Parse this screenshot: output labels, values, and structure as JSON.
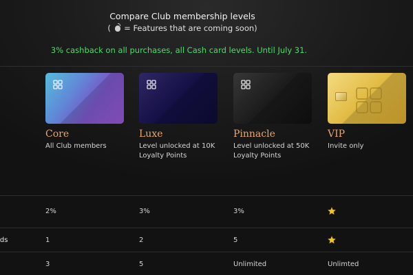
{
  "header": {
    "title": "Compare Club membership levels",
    "subtitle_open": "(",
    "subtitle_rest": " = Features that are coming soon)",
    "coming_soon_icon": "bomb-icon"
  },
  "promo": {
    "text": "3% cashback on all purchases, all Cash card levels. Until July 31.",
    "color": "#4ade6a"
  },
  "tiers": [
    {
      "name": "Core",
      "description": "All Club members",
      "card_style": "blue-purple gradient"
    },
    {
      "name": "Luxe",
      "description": "Level unlocked at 10K Loyalty Points",
      "card_style": "deep indigo"
    },
    {
      "name": "Pinnacle",
      "description": "Level unlocked at 50K Loyalty Points",
      "card_style": "black"
    },
    {
      "name": "VIP",
      "description": "Invite only",
      "card_style": "gold with chip"
    }
  ],
  "accent_color": "#e8a870",
  "rows": [
    {
      "label": "",
      "values": [
        "2%",
        "3%",
        "3%",
        "star-icon"
      ]
    },
    {
      "label": "rds",
      "values": [
        "1",
        "2",
        "5",
        "star-icon"
      ]
    },
    {
      "label": "",
      "values": [
        "3",
        "5",
        "Unlimited",
        "Unlimted"
      ]
    }
  ]
}
